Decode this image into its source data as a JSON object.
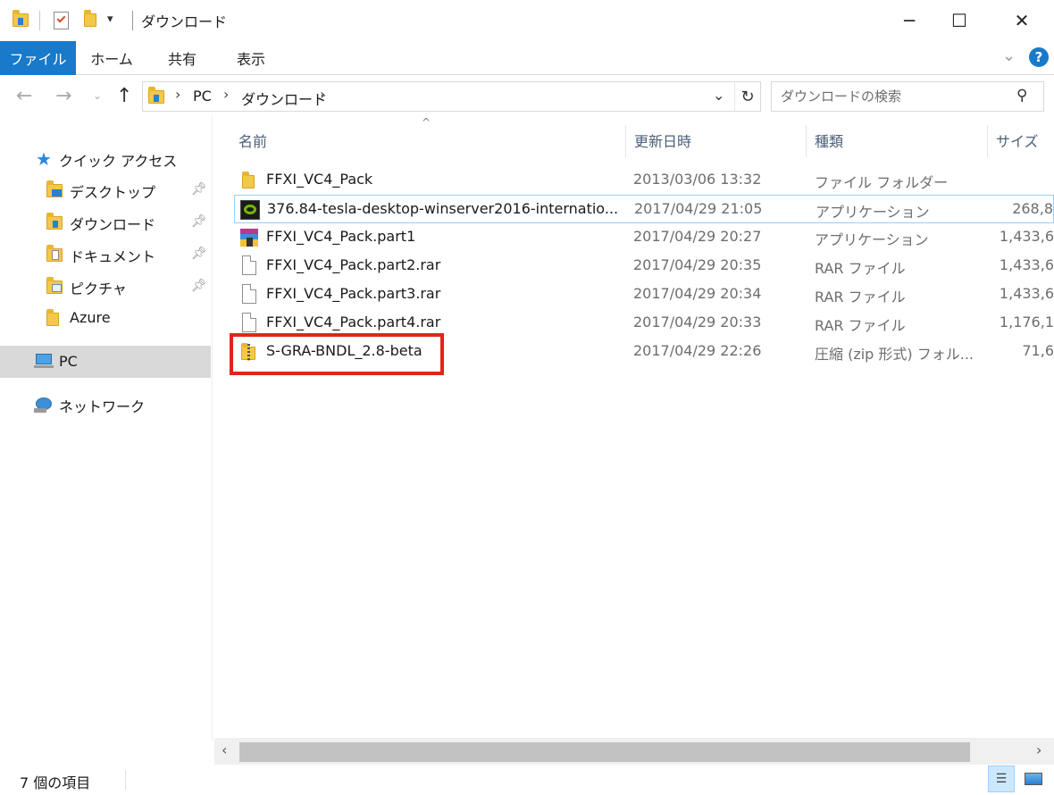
{
  "window": {
    "title": "ダウンロード",
    "minimize": "─",
    "maximize": "☐",
    "close": "✕"
  },
  "ribbon": {
    "tabs": [
      {
        "label": "ファイル",
        "active": true
      },
      {
        "label": "ホーム"
      },
      {
        "label": "共有"
      },
      {
        "label": "表示"
      }
    ],
    "help": "?"
  },
  "address": {
    "crumbs": [
      "PC",
      "ダウンロード"
    ],
    "search_placeholder": "ダウンロードの検索"
  },
  "sidebar": {
    "quick_access": "クイック アクセス",
    "items": [
      {
        "label": "デスクトップ",
        "pinned": true
      },
      {
        "label": "ダウンロード",
        "pinned": true
      },
      {
        "label": "ドキュメント",
        "pinned": true
      },
      {
        "label": "ピクチャ",
        "pinned": true
      },
      {
        "label": "Azure",
        "pinned": false
      }
    ],
    "pc": "PC",
    "network": "ネットワーク"
  },
  "columns": {
    "name": "名前",
    "date": "更新日時",
    "type": "種類",
    "size": "サイズ"
  },
  "files": [
    {
      "name": "FFXI_VC4_Pack",
      "date": "2013/03/06 13:32",
      "type": "ファイル フォルダー",
      "size": "",
      "icon": "folder-icon"
    },
    {
      "name": "376.84-tesla-desktop-winserver2016-internatio...",
      "date": "2017/04/29 21:05",
      "type": "アプリケーション",
      "size": "268,8",
      "icon": "nvidia-installer-icon"
    },
    {
      "name": "FFXI_VC4_Pack.part1",
      "date": "2017/04/29 20:27",
      "type": "アプリケーション",
      "size": "1,433,6",
      "icon": "winrar-sfx-icon"
    },
    {
      "name": "FFXI_VC4_Pack.part2.rar",
      "date": "2017/04/29 20:35",
      "type": "RAR ファイル",
      "size": "1,433,6",
      "icon": "file-icon"
    },
    {
      "name": "FFXI_VC4_Pack.part3.rar",
      "date": "2017/04/29 20:34",
      "type": "RAR ファイル",
      "size": "1,433,6",
      "icon": "file-icon"
    },
    {
      "name": "FFXI_VC4_Pack.part4.rar",
      "date": "2017/04/29 20:33",
      "type": "RAR ファイル",
      "size": "1,176,1",
      "icon": "file-icon"
    },
    {
      "name": "S-GRA-BNDL_2.8-beta",
      "date": "2017/04/29 22:26",
      "type": "圧縮 (zip 形式) フォル...",
      "size": "71,6",
      "icon": "zip-folder-icon"
    }
  ],
  "status": {
    "count_text": "7 個の項目"
  },
  "colors": {
    "accent": "#1979ca",
    "highlight_box": "#e1251b",
    "selection_border": "#99d1ff"
  }
}
